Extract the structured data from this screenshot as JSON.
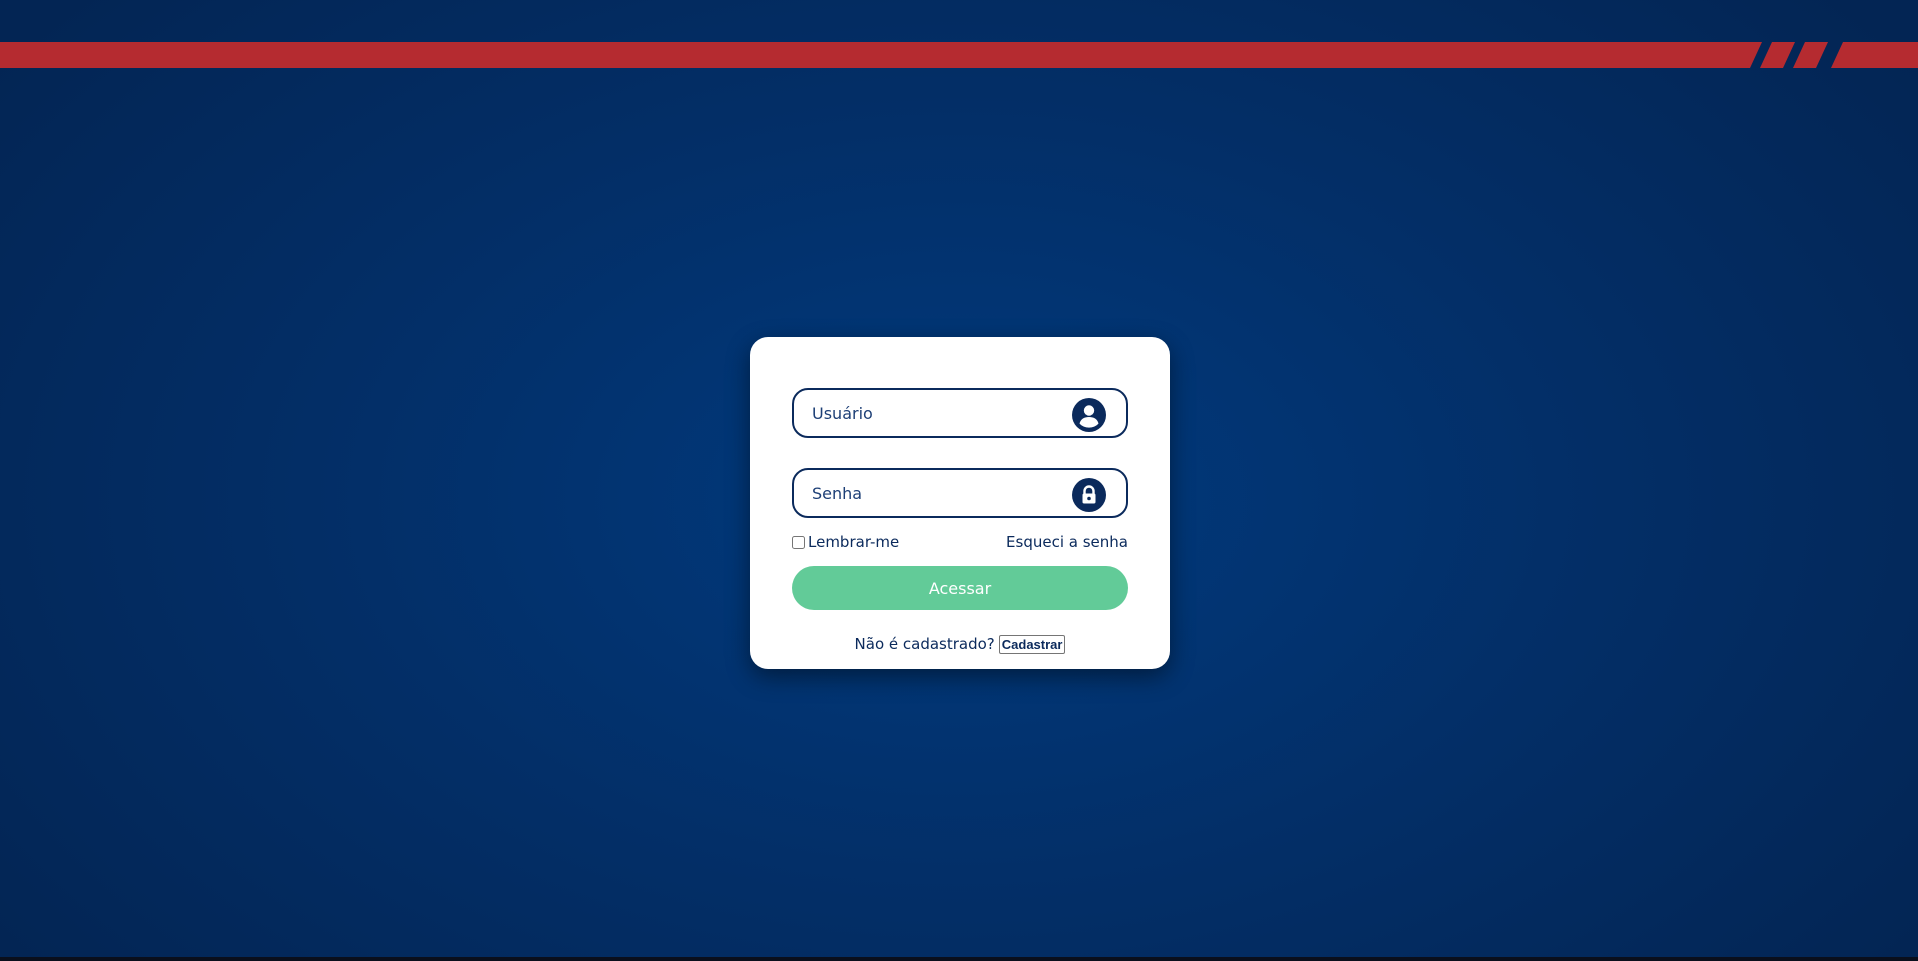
{
  "login": {
    "username_placeholder": "Usuário",
    "password_placeholder": "Senha",
    "remember_label": "Lembrar-me",
    "forgot_label": "Esqueci a senha",
    "submit_label": "Acessar",
    "register_prompt": "Não é cadastrado?",
    "register_label": "Cadastrar"
  },
  "icons": {
    "username": "user-circle-icon",
    "password": "lock-icon"
  },
  "colors": {
    "background": "#032f68",
    "stripe": "#b52b30",
    "card": "#ffffff",
    "primary_text": "#0b2a5c",
    "submit_button": "#62cb98"
  }
}
